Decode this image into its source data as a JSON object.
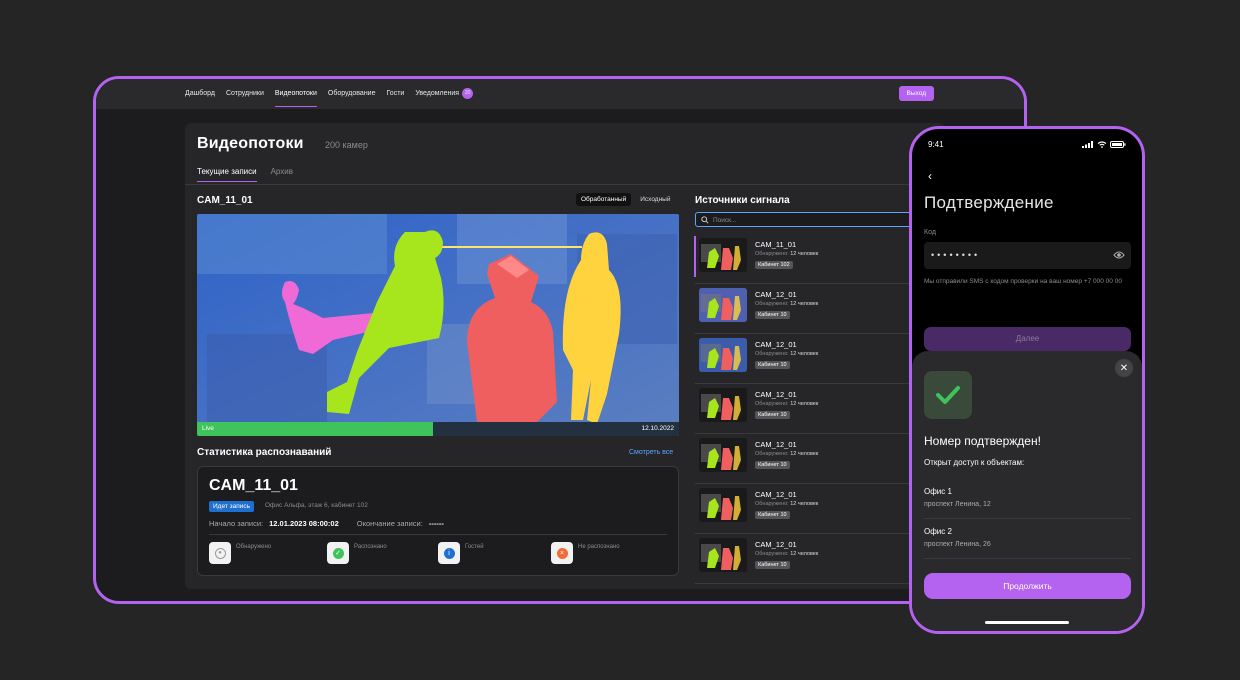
{
  "nav": {
    "items": [
      {
        "label": "Дашборд"
      },
      {
        "label": "Сотрудники"
      },
      {
        "label": "Видеопотоки"
      },
      {
        "label": "Оборудование"
      },
      {
        "label": "Гости"
      },
      {
        "label": "Уведомления",
        "count": "20"
      }
    ],
    "active": "Видеопотоки",
    "logout_label": "Выход"
  },
  "page": {
    "title": "Видеопотоки",
    "subtitle": "200 камер",
    "tabs": [
      "Текущие записи",
      "Архив"
    ]
  },
  "camera": {
    "title": "CAM_11_01",
    "modes": [
      "Обработанный",
      "Исходный"
    ],
    "live_label": "Live",
    "date": "12.10.2022",
    "progress": 0.49
  },
  "stats": {
    "title": "Статистика распознаваний",
    "see_all": "Смотреть все",
    "name": "CAM_11_01",
    "badge": "Идет запись",
    "location": "Офис Альфа, этаж 6, кабинет 102",
    "start_label": "Начало записи:",
    "start_value": "12.01.2023 08:00:02",
    "end_label": "Окончание записи:",
    "end_value": "------",
    "metrics": [
      {
        "label": "Обнаружено",
        "icon": "user-icon",
        "color": "#9a9a9a"
      },
      {
        "label": "Распознано",
        "icon": "check-icon",
        "color": "#3fc35b"
      },
      {
        "label": "Гостей",
        "icon": "info-icon",
        "color": "#1f6fd1"
      },
      {
        "label": "Не распознано",
        "icon": "cross-icon",
        "color": "#f26b3a"
      }
    ]
  },
  "sources": {
    "title": "Источники сигнала",
    "search_placeholder": "Поиск...",
    "items": [
      {
        "name": "CAM_11_01",
        "detected_label": "Обнаружено:",
        "detected": "12 человек",
        "room": "Кабинет 102"
      },
      {
        "name": "CAM_12_01",
        "detected_label": "Обнаружено:",
        "detected": "12 человек",
        "room": "Кабинет 10"
      },
      {
        "name": "CAM_12_01",
        "detected_label": "Обнаружено:",
        "detected": "12 человек",
        "room": "Кабинет 10"
      },
      {
        "name": "CAM_12_01",
        "detected_label": "Обнаружено:",
        "detected": "12 человек",
        "room": "Кабинет 10"
      },
      {
        "name": "CAM_12_01",
        "detected_label": "Обнаружено:",
        "detected": "12 человек",
        "room": "Кабинет 10"
      },
      {
        "name": "CAM_12_01",
        "detected_label": "Обнаружено:",
        "detected": "12 человек",
        "room": "Кабинет 10"
      },
      {
        "name": "CAM_12_01",
        "detected_label": "Обнаружено:",
        "detected": "12 человек",
        "room": "Кабинет 10"
      }
    ]
  },
  "phone": {
    "time": "9:41",
    "title": "Подтверждение",
    "code_label": "Код",
    "code_value": "••••••••",
    "sms_text": "Мы отправили SMS с кодом проверки на ваш номер +7 000 00 00",
    "next_label": "Далее",
    "sheet_title": "Номер подтвержден!",
    "sheet_sub": "Открыт доступ к объектам:",
    "offices": [
      {
        "name": "Офис 1",
        "address": "проспект Ленина, 12"
      },
      {
        "name": "Офис 2",
        "address": "проспект Ленина, 26"
      }
    ],
    "continue_label": "Продолжить"
  },
  "colors": {
    "accent": "#b463f0",
    "live": "#3fc35b",
    "link": "#5aa6ff"
  }
}
